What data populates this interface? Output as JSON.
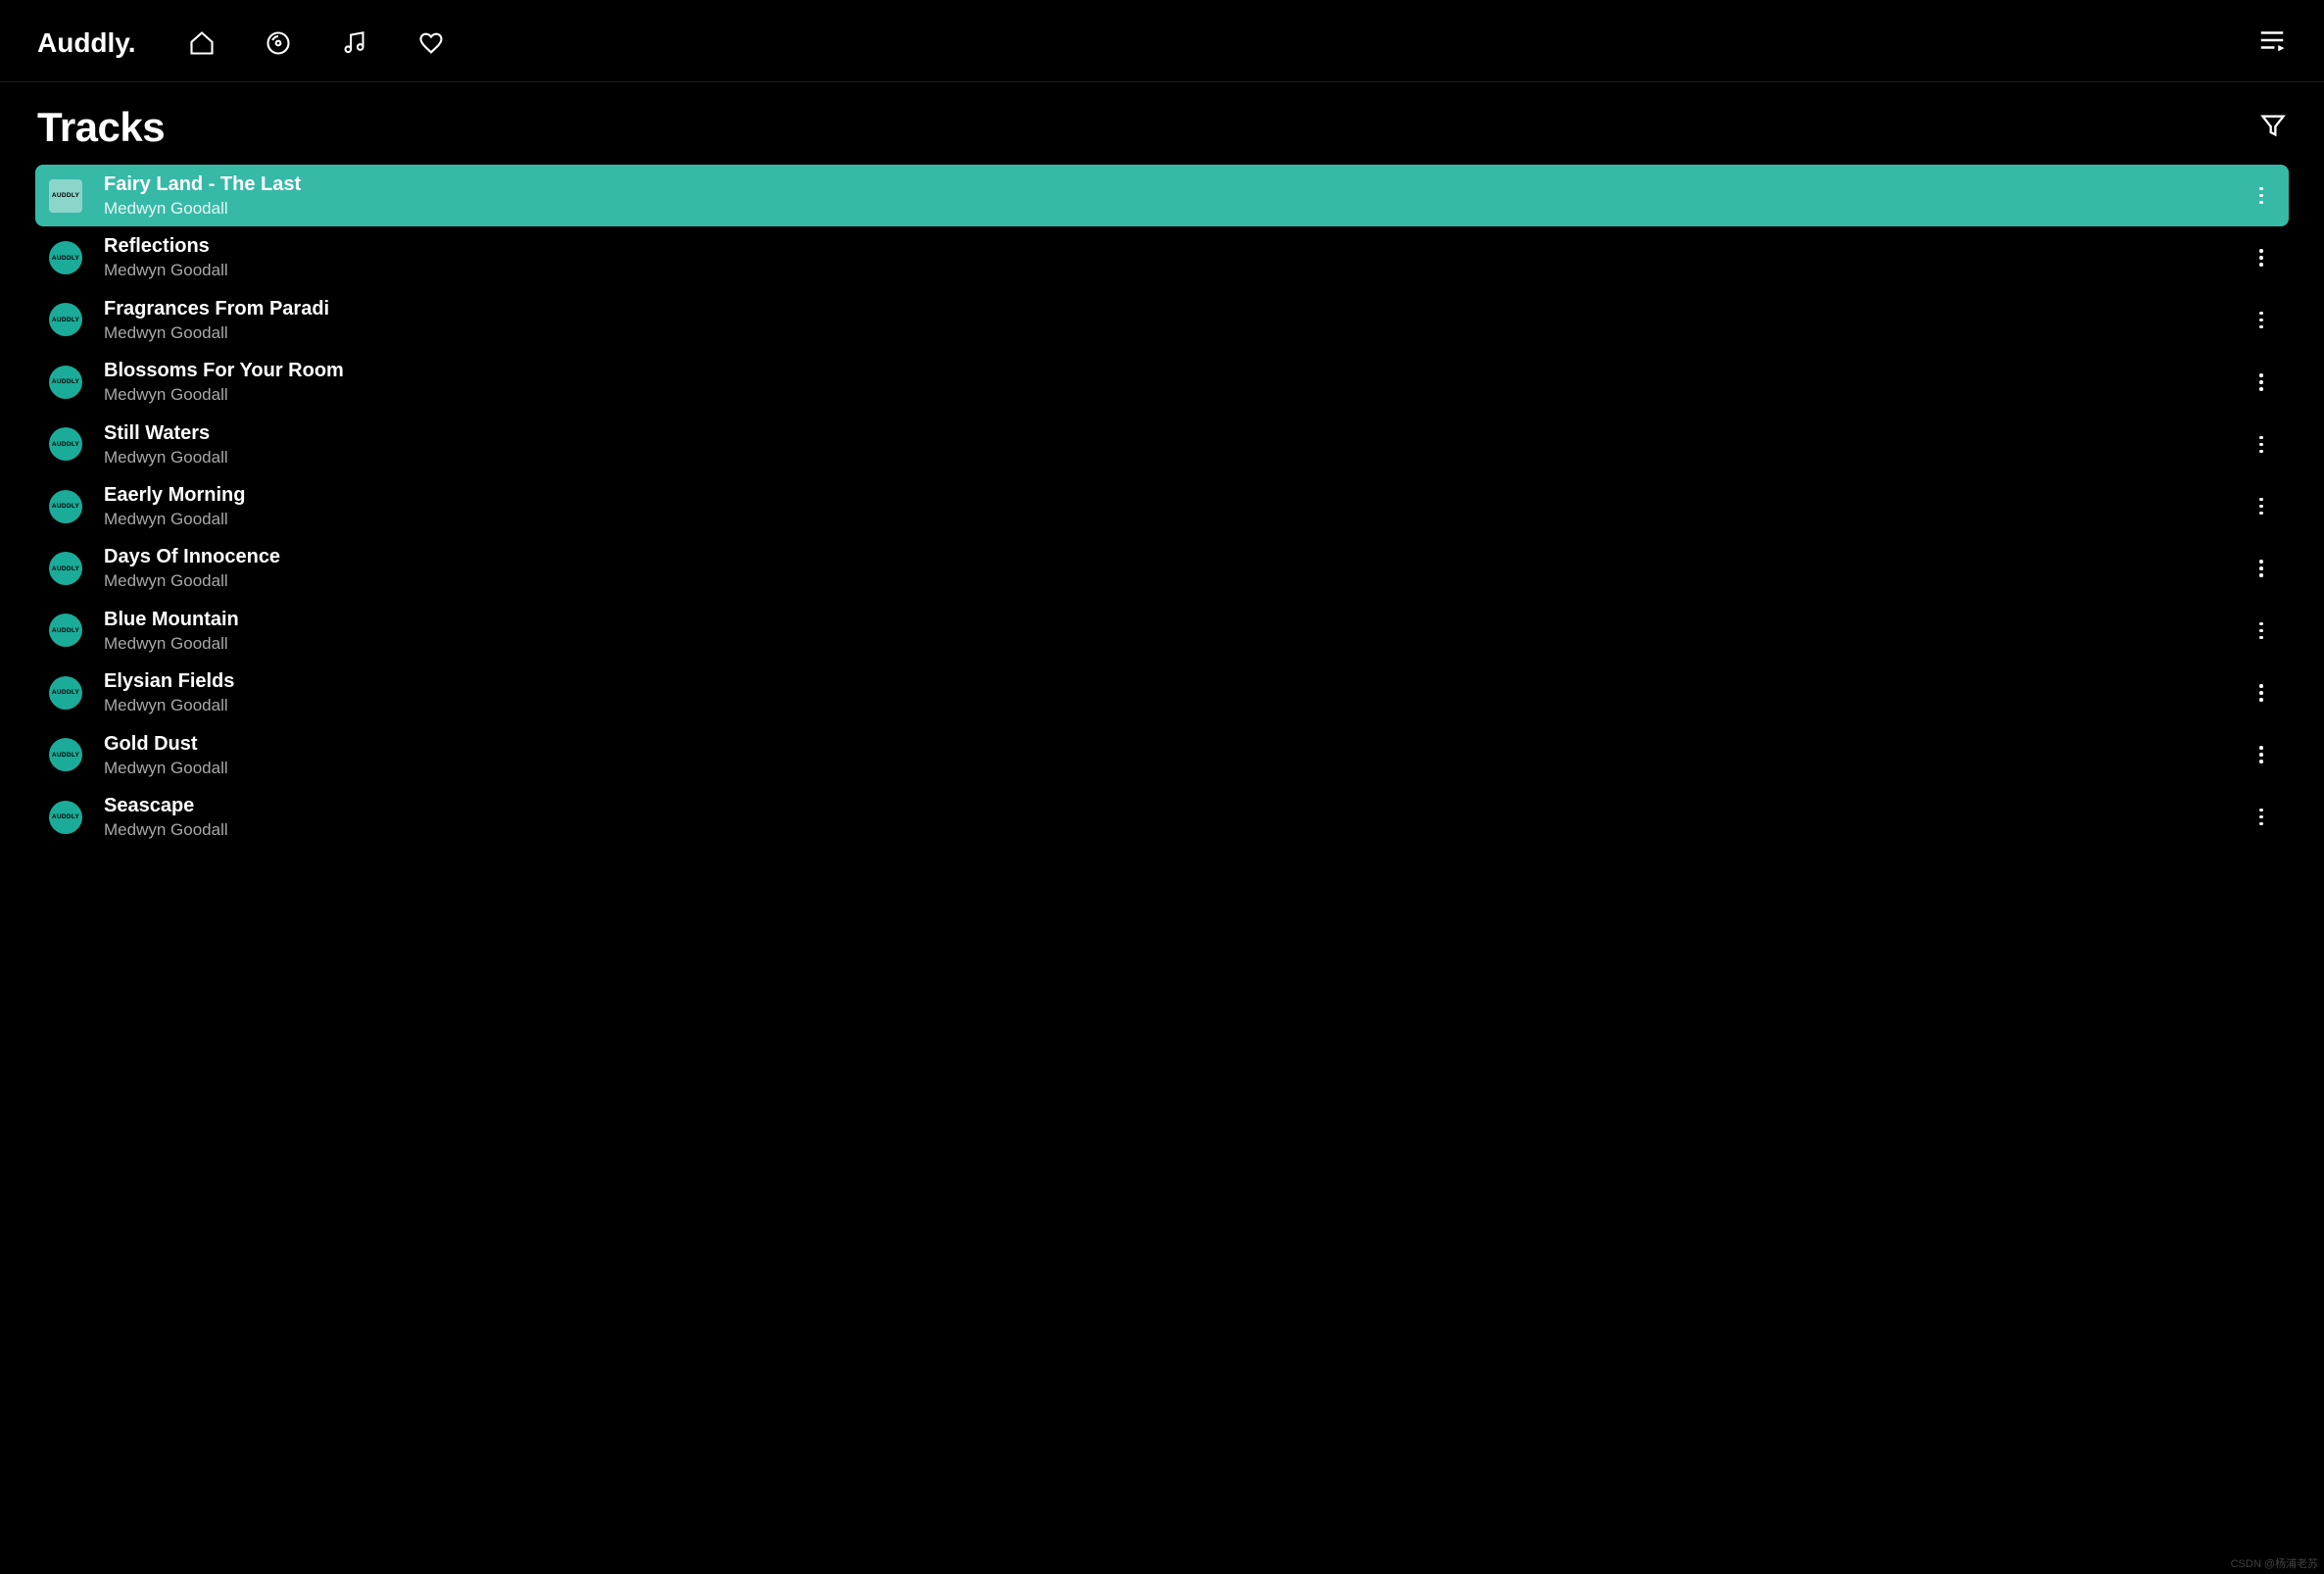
{
  "app": {
    "logo": "Auddly."
  },
  "page": {
    "title": "Tracks"
  },
  "tracks": [
    {
      "title": "Fairy Land - The Last",
      "artist": "Medwyn Goodall",
      "active": true
    },
    {
      "title": "Reflections",
      "artist": "Medwyn Goodall",
      "active": false
    },
    {
      "title": "Fragrances From Paradi",
      "artist": "Medwyn Goodall",
      "active": false
    },
    {
      "title": "Blossoms For Your Room",
      "artist": "Medwyn Goodall",
      "active": false
    },
    {
      "title": "Still Waters",
      "artist": "Medwyn Goodall",
      "active": false
    },
    {
      "title": "Eaerly Morning",
      "artist": "Medwyn Goodall",
      "active": false
    },
    {
      "title": "Days Of Innocence",
      "artist": "Medwyn Goodall",
      "active": false
    },
    {
      "title": "Blue Mountain",
      "artist": "Medwyn Goodall",
      "active": false
    },
    {
      "title": "Elysian Fields",
      "artist": "Medwyn Goodall",
      "active": false
    },
    {
      "title": "Gold Dust",
      "artist": "Medwyn Goodall",
      "active": false
    },
    {
      "title": "Seascape",
      "artist": "Medwyn Goodall",
      "active": false
    }
  ],
  "art_label": "AUDDLY",
  "watermark": "CSDN @杨浦老苏"
}
